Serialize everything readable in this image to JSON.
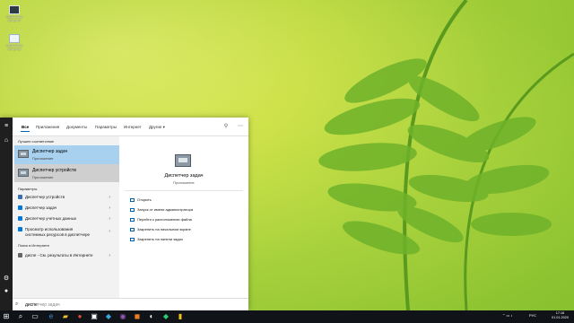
{
  "desktop": {
    "icons": [
      {
        "label_line1": "2020-01-08",
        "label_line2": "07-31-07"
      },
      {
        "label_line1": "2020-01-08",
        "label_line2": "07-31-18"
      }
    ]
  },
  "search": {
    "tabs": [
      "Все",
      "Приложения",
      "Документы",
      "Параметры",
      "Интернет",
      "Другие ▾"
    ],
    "best_match_header": "Лучшее соответствие",
    "best_match": {
      "title": "Диспетчер задач",
      "subtitle": "Приложение"
    },
    "second_match": {
      "title": "Диспетчер устройств",
      "subtitle": "Приложение"
    },
    "settings_header": "Параметры",
    "settings": [
      "Диспетчер устройств",
      "Диспетчер задач",
      "Диспетчер учетных данных",
      "Просмотр использования",
      "системных ресурсов в диспетчере"
    ],
    "internet_header": "Поиск в Интернете",
    "internet_item": "диспе - См. результаты в Интернете",
    "preview": {
      "title": "Диспетчер задач",
      "subtitle": "Приложение",
      "actions": [
        "Открыть",
        "Запуск от имени администратора",
        "Перейти к расположению файла",
        "Закрепить на начальном экране",
        "Закрепить на панели задач"
      ]
    },
    "query_typed": "диспе",
    "query_hint": "тчер задач"
  },
  "taskbar": {
    "tray_lang": "РУС",
    "time": "17:16",
    "date": "01.01.2020"
  },
  "colors": {
    "accent": "#0063b1",
    "best_match_bg": "#a8d0ef",
    "taskbar_bg": "#101418"
  }
}
